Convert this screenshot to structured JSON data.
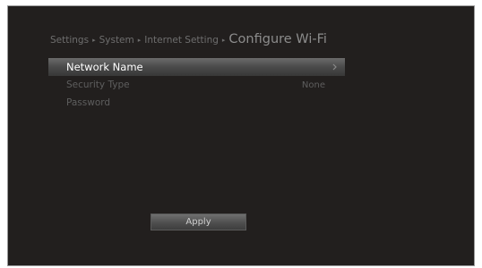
{
  "breadcrumb": {
    "items": [
      "Settings",
      "System",
      "Internet Setting"
    ],
    "separator": "▸",
    "current": "Configure Wi-Fi"
  },
  "menu": {
    "items": [
      {
        "label": "Network Name",
        "value": "",
        "state": "selected"
      },
      {
        "label": "Security Type",
        "value": "None",
        "state": "disabled"
      },
      {
        "label": "Password",
        "value": "",
        "state": "disabled"
      }
    ]
  },
  "buttons": {
    "apply_label": "Apply"
  },
  "icons": {
    "selected_row_chevron": "chevron-right-icon"
  },
  "colors": {
    "background": "#221f1e",
    "highlight": "#5a5a5a",
    "text_active": "#ffffff",
    "text_dim": "#5e5e5e"
  }
}
